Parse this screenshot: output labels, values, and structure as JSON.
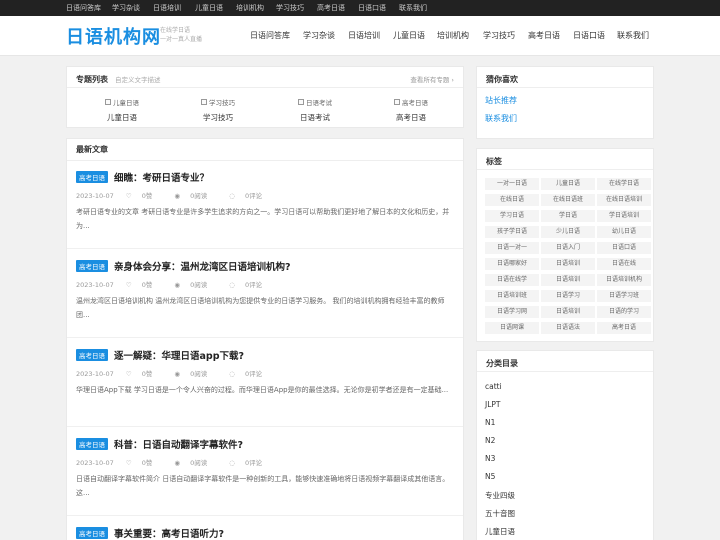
{
  "topbar": {
    "items": [
      "日语问答库",
      "学习杂谈",
      "日语培训",
      "儿童日语",
      "培训机构",
      "学习技巧",
      "高考日语",
      "日语口语",
      "联系我们"
    ]
  },
  "header": {
    "logo": "日语机构网",
    "slogan_line1": "在线学日语",
    "slogan_line2": "一对一真人直播",
    "nav": [
      "日语问答库",
      "学习杂谈",
      "日语培训",
      "儿童日语",
      "培训机构",
      "学习技巧",
      "高考日语",
      "日语口语",
      "联系我们"
    ]
  },
  "topics": {
    "title": "专题列表",
    "subtitle": "自定义文字描述",
    "more": "查看所有专题",
    "more_icon": "chevron-right-icon",
    "items": [
      {
        "image_alt": "儿童日语",
        "label": "儿童日语"
      },
      {
        "image_alt": "学习技巧",
        "label": "学习技巧"
      },
      {
        "image_alt": "日语考试",
        "label": "日语考试"
      },
      {
        "image_alt": "高考日语",
        "label": "高考日语"
      }
    ]
  },
  "latest": {
    "title": "最新文章",
    "articles": [
      {
        "category": "高考日语",
        "title": "细瞧：考研日语专业？",
        "date": "2023-10-07",
        "likes": "0赞",
        "views": "0阅读",
        "comments": "0评论",
        "excerpt": "考研日语专业的文章 考研日语专业是许多学生追求的方向之一。学习日语可以帮助我们更好地了解日本的文化和历史，并为..."
      },
      {
        "category": "高考日语",
        "title": "亲身体会分享：温州龙湾区日语培训机构?",
        "date": "2023-10-07",
        "likes": "0赞",
        "views": "0阅读",
        "comments": "0评论",
        "excerpt": "温州龙湾区日语培训机构 温州龙湾区日语培训机构为您提供专业的日语学习服务。 我们的培训机构拥有经验丰富的教师团..."
      },
      {
        "category": "高考日语",
        "title": "逐一解疑：华理日语app下载?",
        "date": "2023-10-07",
        "likes": "0赞",
        "views": "0阅读",
        "comments": "0评论",
        "excerpt": "华理日语App下载 学习日语是一个令人兴奋的过程。而华理日语App是你的最佳选择。无论你是初学者还是有一定基础..."
      },
      {
        "category": "高考日语",
        "title": "科普：日语自动翻译字幕软件?",
        "date": "2023-10-07",
        "likes": "0赞",
        "views": "0阅读",
        "comments": "0评论",
        "excerpt": "日语自动翻译字幕软件简介 日语自动翻译字幕软件是一种创新的工具，能够快速准确地将日语视频字幕翻译成其他语言。这..."
      },
      {
        "category": "高考日语",
        "title": "事关重要：高考日语听力?"
      }
    ]
  },
  "sidebar": {
    "guess": {
      "title": "猜你喜欢",
      "links": [
        "站长推荐",
        "联系我们"
      ]
    },
    "tags": {
      "title": "标签",
      "items": [
        "一对一日语",
        "儿童日语",
        "在线学日语",
        "在线日语",
        "在线日语班",
        "在线日语培训",
        "学习日语",
        "学日语",
        "学日语培训",
        "孩子学日语",
        "少儿日语",
        "幼儿日语",
        "日语一对一",
        "日语入门",
        "日语口语",
        "日语哪家好",
        "日语培训",
        "日语在线",
        "日语在线学",
        "日语培训",
        "日语培训机构",
        "日语培训班",
        "日语学习",
        "日语学习班",
        "日语学习网",
        "日语培训",
        "日语的学习",
        "日语网课",
        "日语语法",
        "高考日语"
      ]
    },
    "categories": {
      "title": "分类目录",
      "items": [
        "catti",
        "JLPT",
        "N1",
        "N2",
        "N3",
        "N5",
        "专业四级",
        "五十音图",
        "儿童日语"
      ]
    }
  }
}
